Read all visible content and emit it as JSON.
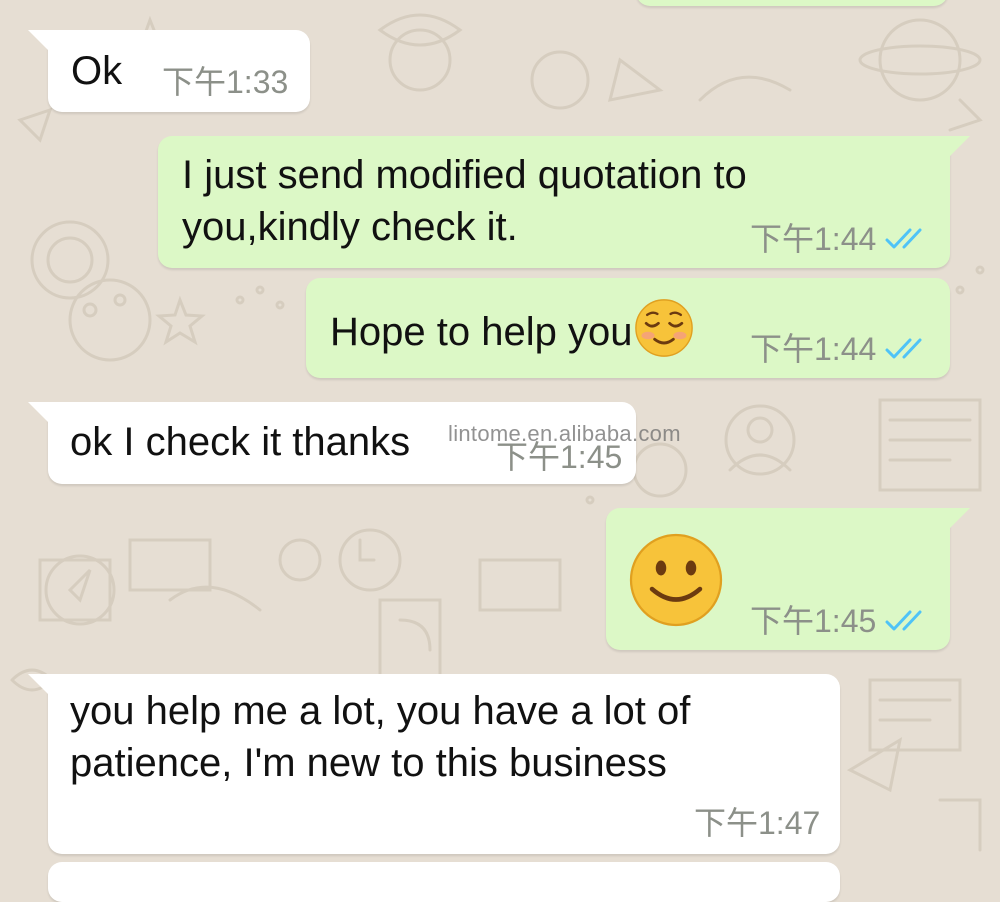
{
  "colors": {
    "background": "#e6ded3",
    "incoming_bubble": "#ffffff",
    "outgoing_bubble": "#dcf8c6",
    "timestamp": "#8c9089",
    "read_ticks": "#4fc3f7"
  },
  "watermark": "lintome.en.alibaba.com",
  "messages": [
    {
      "direction": "incoming",
      "text": "Ok",
      "time": "下午1:33"
    },
    {
      "direction": "outgoing",
      "lines": [
        "I just send modified quotation to",
        "you,kindly check it."
      ],
      "time": "下午1:44",
      "status_icon": "double-check-read-icon"
    },
    {
      "direction": "outgoing",
      "text": "Hope to help you",
      "emoji": "relieved-face-emoji",
      "time": "下午1:44",
      "status_icon": "double-check-read-icon"
    },
    {
      "direction": "incoming",
      "text": "ok I check it thanks",
      "time": "下午1:45"
    },
    {
      "direction": "outgoing",
      "emoji": "slightly-smiling-face-emoji",
      "time": "下午1:45",
      "status_icon": "double-check-read-icon"
    },
    {
      "direction": "incoming",
      "lines": [
        "you help me a lot, you have a lot of",
        "patience, I'm new to this business"
      ],
      "time": "下午1:47"
    }
  ]
}
